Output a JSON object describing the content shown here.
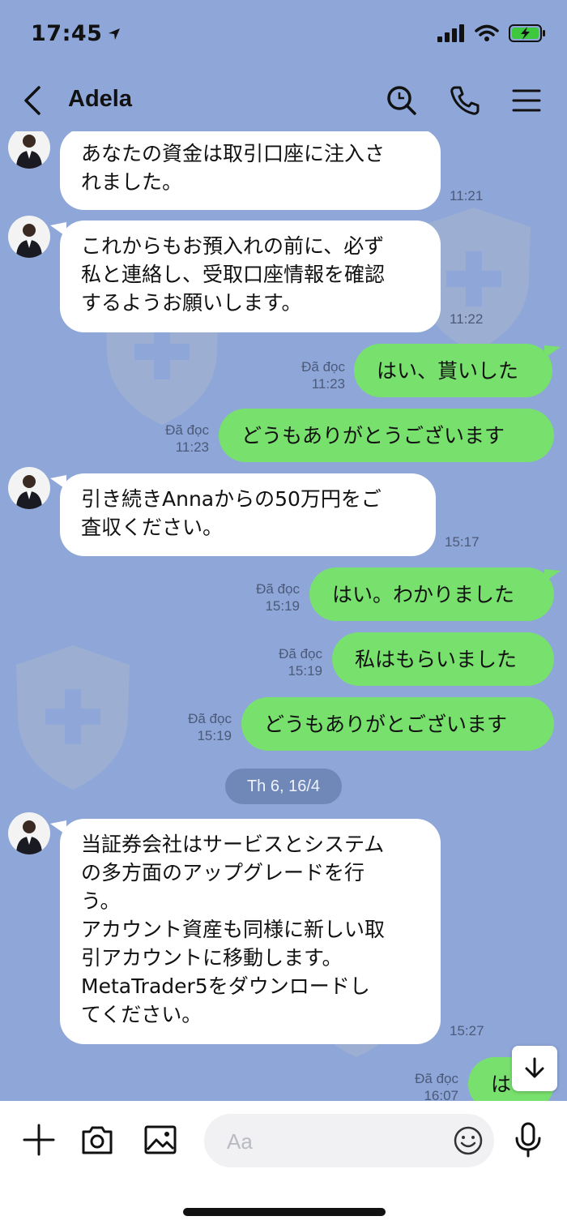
{
  "status_bar": {
    "time": "17:45"
  },
  "header": {
    "contact_name": "Adela"
  },
  "messages": [
    {
      "direction": "in",
      "text": "あなたの資金は取引口座に注入さ\nれました。",
      "time": "11:21"
    },
    {
      "direction": "in",
      "text": "これからもお預入れの前に、必ず\n私と連絡し、受取口座情報を確認\nするようお願いします。",
      "time": "11:22"
    },
    {
      "direction": "out",
      "text": "はい、貰いした",
      "read": "Đã đọc",
      "time": "11:23"
    },
    {
      "direction": "out",
      "text": "どうもありがとうございます",
      "read": "Đã đọc",
      "time": "11:23"
    },
    {
      "direction": "in",
      "text": "引き続きAnnaからの50万円をご\n査収ください。",
      "time": "15:17"
    },
    {
      "direction": "out",
      "text": "はい。わかりました",
      "read": "Đã đọc",
      "time": "15:19"
    },
    {
      "direction": "out",
      "text": "私はもらいました",
      "read": "Đã đọc",
      "time": "15:19"
    },
    {
      "direction": "out",
      "text": "どうもありがとございます",
      "read": "Đã đọc",
      "time": "15:19"
    },
    {
      "direction": "in",
      "text": "当証券会社はサービスとシステム\nの多方面のアップグレードを行\nう。\nアカウント資産も同様に新しい取\n引アカウントに移動します。\nMetaTrader5をダウンロードし\nてください。",
      "time": "15:27"
    },
    {
      "direction": "out",
      "text": "は",
      "read": "Đã đọc",
      "time": "16:07"
    }
  ],
  "date_separator": "Th 6, 16/4",
  "input": {
    "placeholder": "Aa"
  },
  "colors": {
    "background": "#8ea6d8",
    "outgoing_bubble": "#78e06d",
    "incoming_bubble": "#ffffff"
  },
  "icons": [
    "back-icon",
    "search-icon",
    "phone-icon",
    "menu-icon",
    "plus-icon",
    "camera-icon",
    "image-icon",
    "emoji-icon",
    "mic-icon",
    "arrow-down-icon",
    "location-arrow-icon",
    "signal-icon",
    "wifi-icon",
    "battery-icon"
  ]
}
